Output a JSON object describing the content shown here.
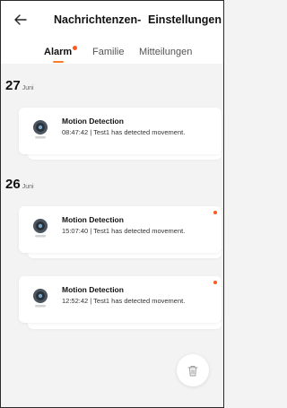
{
  "header": {
    "back_icon": "arrow-left-icon",
    "title": "Nachrichtenzen-",
    "settings_label": "Einstellungen"
  },
  "tabs": [
    {
      "label": "Alarm",
      "active": true,
      "has_badge": true
    },
    {
      "label": "Familie",
      "active": false,
      "has_badge": false
    },
    {
      "label": "Mitteilungen",
      "active": false,
      "has_badge": false
    }
  ],
  "groups": [
    {
      "day": "27",
      "month": "Juni",
      "items": [
        {
          "title": "Motion Detection",
          "desc": "08:47:42 | Test1 has detected movement.",
          "unread": false
        }
      ]
    },
    {
      "day": "26",
      "month": "Juni",
      "items": [
        {
          "title": "Motion Detection",
          "desc": "15:07:40 | Test1 has detected movement.",
          "unread": true
        },
        {
          "title": "Motion Detection",
          "desc": "12:52:42 | Test1 has detected movement.",
          "unread": true
        }
      ]
    }
  ],
  "fab": {
    "icon": "trash-icon"
  },
  "colors": {
    "accent": "#ff5a1f",
    "background": "#f3f3f3",
    "card": "#ffffff"
  }
}
